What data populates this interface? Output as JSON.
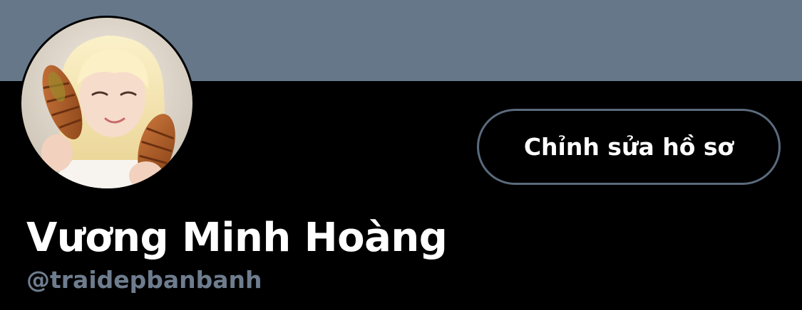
{
  "profile": {
    "banner_color": "#66778a",
    "avatar_icon": "profile-photo",
    "edit_button_label": "Chỉnh sửa hồ sơ",
    "display_name": "Vương Minh Hoàng",
    "handle": "@traidepbanbanh"
  },
  "colors": {
    "background": "#000000",
    "text_primary": "#ffffff",
    "text_secondary": "#6e7d8e",
    "button_border": "#5b6b7d"
  }
}
